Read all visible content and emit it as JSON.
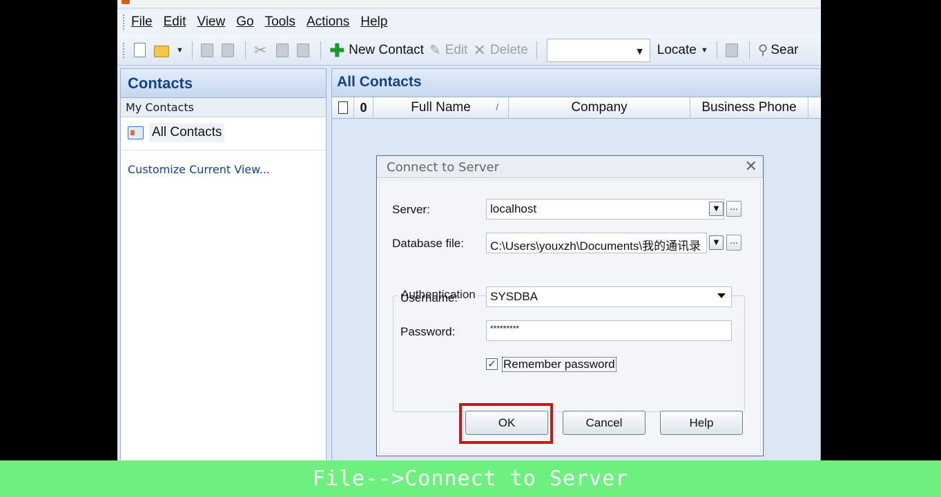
{
  "menubar": {
    "items": [
      {
        "label": "File"
      },
      {
        "label": "Edit"
      },
      {
        "label": "View"
      },
      {
        "label": "Go"
      },
      {
        "label": "Tools"
      },
      {
        "label": "Actions"
      },
      {
        "label": "Help"
      }
    ]
  },
  "toolbar": {
    "new_contact": "New Contact",
    "edit": "Edit",
    "delete": "Delete",
    "combo_value": "",
    "locate": "Locate",
    "search": "Sear"
  },
  "left_pane": {
    "header": "Contacts",
    "group": "My Contacts",
    "items": [
      {
        "label": "All Contacts"
      }
    ],
    "customize_link": "Customize Current View..."
  },
  "right_pane": {
    "header": "All Contacts",
    "columns": [
      {
        "label": "Full Name"
      },
      {
        "label": "Company"
      },
      {
        "label": "Business Phone"
      }
    ]
  },
  "dialog": {
    "title": "Connect to Server",
    "server_label": "Server:",
    "server_value": "localhost",
    "database_label": "Database file:",
    "database_value": "C:\\Users\\youxzh\\Documents\\我的通讯录",
    "auth_group": "Authentication",
    "username_label": "Username:",
    "username_value": "SYSDBA",
    "password_label": "Password:",
    "password_value": "*********",
    "remember_label": "Remember password",
    "remember_checked": true,
    "ok": "OK",
    "cancel": "Cancel",
    "help": "Help"
  },
  "caption": "File-->Connect to Server"
}
